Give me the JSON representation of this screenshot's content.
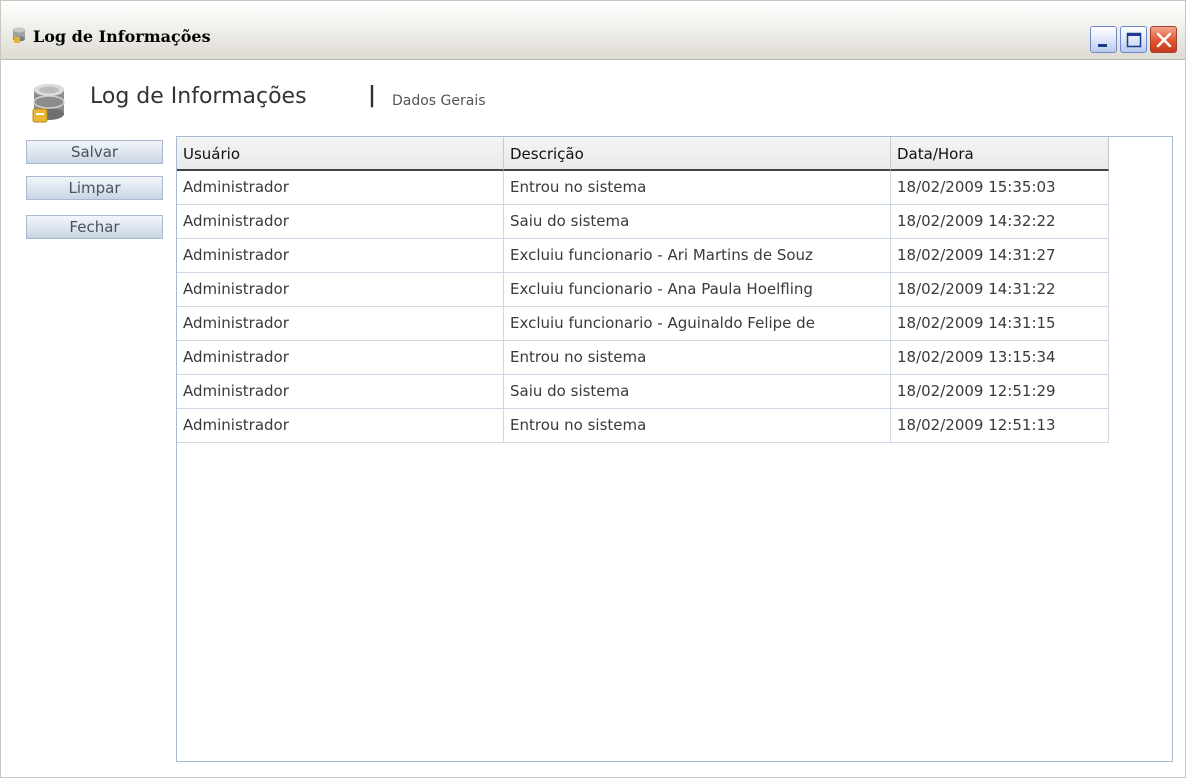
{
  "window": {
    "title": "Log de Informações",
    "controls": {
      "minimize_icon": "minimize-icon",
      "maximize_icon": "maximize-icon",
      "close_icon": "close-icon"
    },
    "close_color": "#e2552f"
  },
  "header": {
    "icon": "database-icon",
    "title": "Log de Informações",
    "separator": "|",
    "subtitle": "Dados Gerais"
  },
  "actions": {
    "save_label": "Salvar",
    "clear_label": "Limpar",
    "close_label": "Fechar"
  },
  "table": {
    "columns": [
      "Usuário",
      "Descrição",
      "Data/Hora"
    ],
    "rows": [
      [
        "Administrador",
        "Entrou no sistema",
        "18/02/2009 15:35:03"
      ],
      [
        "Administrador",
        "Saiu do sistema",
        "18/02/2009 14:32:22"
      ],
      [
        "Administrador",
        "Excluiu funcionario - Ari Martins de Souz",
        "18/02/2009 14:31:27"
      ],
      [
        "Administrador",
        "Excluiu funcionario - Ana Paula Hoelfling",
        "18/02/2009 14:31:22"
      ],
      [
        "Administrador",
        "Excluiu funcionario - Aguinaldo Felipe de",
        "18/02/2009 14:31:15"
      ],
      [
        "Administrador",
        "Entrou no sistema",
        "18/02/2009 13:15:34"
      ],
      [
        "Administrador",
        "Saiu do sistema",
        "18/02/2009 12:51:29"
      ],
      [
        "Administrador",
        "Entrou no sistema",
        "18/02/2009 12:51:13"
      ]
    ]
  }
}
